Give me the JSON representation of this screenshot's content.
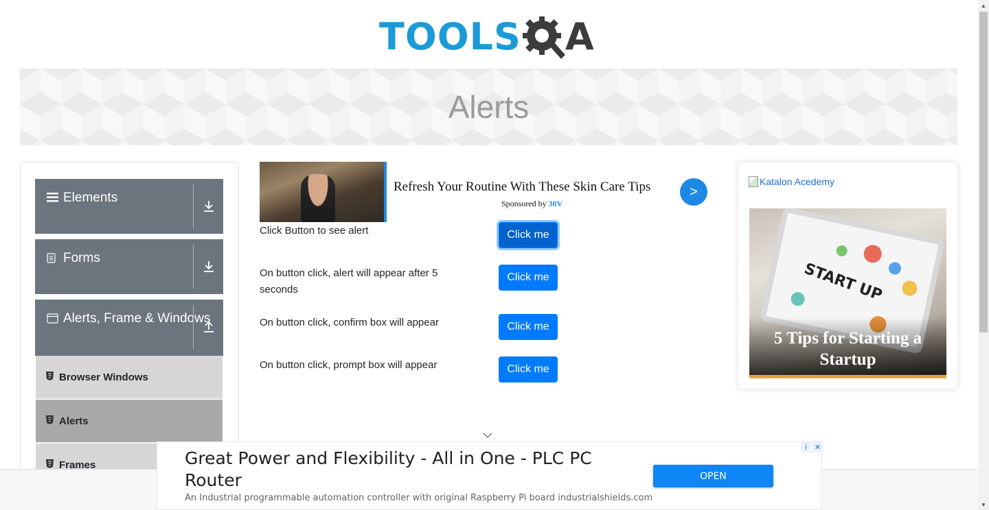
{
  "logo": {
    "part1": "TOOLS",
    "part2": "A"
  },
  "page_title": "Alerts",
  "sidebar": {
    "groups": [
      {
        "label": "Elements",
        "icon": "hamburger-icon",
        "toggle": "download-arrow-icon"
      },
      {
        "label": "Forms",
        "icon": "document-icon",
        "toggle": "download-arrow-icon"
      },
      {
        "label": "Alerts, Frame & Windows",
        "icon": "window-icon",
        "toggle": "upload-arrow-icon"
      }
    ],
    "sub_items": [
      {
        "label": "Browser Windows",
        "active": false
      },
      {
        "label": "Alerts",
        "active": true
      },
      {
        "label": "Frames",
        "active": false
      }
    ]
  },
  "top_ad": {
    "title": "Refresh Your Routine With These Skin Care Tips",
    "sponsored_prefix": "Sponsored by ",
    "sponsor": "30V",
    "arrow": ">"
  },
  "alerts": [
    {
      "text": "Click Button to see alert",
      "button": "Click me"
    },
    {
      "text": "On button click, alert will appear after 5 seconds",
      "button": "Click me"
    },
    {
      "text": "On button click, confirm box will appear",
      "button": "Click me"
    },
    {
      "text": "On button click, prompt box will appear",
      "button": "Click me"
    }
  ],
  "right_ad": {
    "alt_text": "Katalon Acedemy",
    "tablet_text": "START UP",
    "title": "5 Tips for Starting a Startup"
  },
  "bottom_ad": {
    "title": "Great Power and Flexibility - All in One - PLC PC Router",
    "description": "An Industrial programmable automation controller with original Raspberry Pi board industrialshields.com",
    "cta": "OPEN",
    "info": "i",
    "close": "✕"
  },
  "colors": {
    "primary_button": "#007bff",
    "sidebar_group": "#6c757d",
    "logo_blue": "#1a9ad6"
  }
}
